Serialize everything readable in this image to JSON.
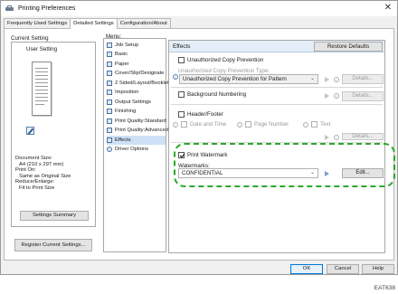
{
  "window": {
    "title": "Printing Preferences",
    "close_glyph": "✕"
  },
  "tabs": [
    "Frequently Used Settings",
    "Detailed Settings",
    "Configuration/About"
  ],
  "current_setting": {
    "label": "Current Setting",
    "name": "User Setting",
    "doc_size_label": "Document Size:",
    "doc_size_value": "A4 (210 x 297 mm)",
    "print_on_label": "Print On:",
    "print_on_value": "Same as Original Size",
    "reduce_label": "Reduce/Enlarge:",
    "reduce_value": "Fit to Print Size",
    "summary_button": "Settings Summary",
    "register_button": "Register Current Settings..."
  },
  "menu": {
    "label": "Menu:",
    "items": [
      "Job Setup",
      "Basic",
      "Paper",
      "Cover/Slip/Designate",
      "2 Sided/Layout/Booklet",
      "Imposition",
      "Output Settings",
      "Finishing",
      "Print Quality:Standard",
      "Print Quality:Advanced",
      "Effects",
      "Driver Options"
    ],
    "selected_index": 10
  },
  "effects": {
    "header": "Effects",
    "restore_button": "Restore Defaults",
    "unauth_copy_label": "Unauthorized Copy Prevention",
    "unauth_type_label": "Unauthorized Copy Prevention Type:",
    "unauth_type_value": "Unauthorized Copy Prevention for Pattern",
    "background_numbering_label": "Background Numbering",
    "header_footer_label": "Header/Footer",
    "date_time_label": "Date and Time",
    "page_number_label": "Page Number",
    "text_label": "Text",
    "details_label": "Details...",
    "print_watermark_label": "Print Watermark",
    "print_watermark_checked": true,
    "watermarks_label": "Watermarks:",
    "watermark_value": "CONFIDENTIAL",
    "edit_button": "Edit..."
  },
  "footer": {
    "ok": "OK",
    "cancel": "Cancel",
    "help": "Help"
  },
  "figure_code": "EAT638",
  "colors": {
    "highlight": "#2aa82a",
    "selected_menu": "#cde0f5",
    "panel_header": "#e4eef8",
    "accent": "#0078d7"
  }
}
